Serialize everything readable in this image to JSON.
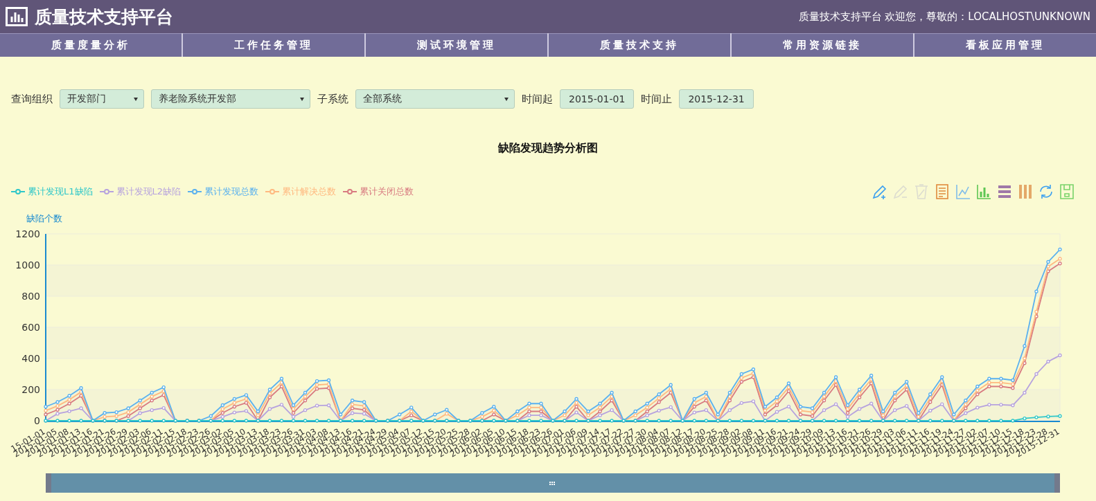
{
  "header": {
    "title": "质量技术支持平台",
    "greeting": "质量技术支持平台 欢迎您，尊敬的：LOCALHOST\\UNKNOWN"
  },
  "nav": [
    {
      "label": "质量度量分析"
    },
    {
      "label": "工作任务管理"
    },
    {
      "label": "测试环境管理"
    },
    {
      "label": "质量技术支持"
    },
    {
      "label": "常用资源链接"
    },
    {
      "label": "看板应用管理"
    }
  ],
  "filters": [
    {
      "kind": "label",
      "text": "查询组织"
    },
    {
      "kind": "select",
      "value": "开发部门"
    },
    {
      "kind": "select",
      "value": "养老险系统开发部"
    },
    {
      "kind": "label",
      "text": "子系统"
    },
    {
      "kind": "select",
      "value": "全部系统"
    },
    {
      "kind": "label",
      "text": "时间起"
    },
    {
      "kind": "date",
      "value": "2015-01-01"
    },
    {
      "kind": "label",
      "text": "时间止"
    },
    {
      "kind": "date",
      "value": "2015-12-31"
    }
  ],
  "chart": {
    "toolbox": [
      {
        "kind": "mark",
        "disabled": false
      },
      {
        "kind": "mark-undo",
        "disabled": true
      },
      {
        "kind": "mark-clear",
        "disabled": true
      },
      {
        "kind": "data-view",
        "disabled": false
      },
      {
        "kind": "line",
        "disabled": false
      },
      {
        "kind": "bar",
        "disabled": false
      },
      {
        "kind": "stack",
        "disabled": false
      },
      {
        "kind": "tiled",
        "disabled": false
      },
      {
        "kind": "restore",
        "disabled": false
      },
      {
        "kind": "save",
        "disabled": false
      }
    ],
    "chart_data": {
      "type": "line",
      "title": "缺陷发现趋势分析图",
      "ylabel": "缺陷个数",
      "ylim": [
        0,
        1200
      ],
      "yticks": [
        0,
        200,
        400,
        600,
        800,
        1000,
        1200
      ],
      "categories": [
        "15-01-01",
        "2015-01-05",
        "2015-01-08",
        "2015-01-13",
        "2015-01-16",
        "2015-01-21",
        "2015-01-26",
        "2015-01-29",
        "2015-02-03",
        "2015-02-06",
        "2015-02-11",
        "2015-02-15",
        "2015-02-18",
        "2015-02-23",
        "2015-02-26",
        "2015-03-02",
        "2015-03-05",
        "2015-03-10",
        "2015-03-13",
        "2015-03-18",
        "2015-03-23",
        "2015-03-26",
        "2015-03-31",
        "2015-04-03",
        "2015-04-08",
        "2015-04-13",
        "2015-04-16",
        "2015-04-21",
        "2015-04-24",
        "2015-04-29",
        "2015-05-04",
        "2015-05-07",
        "2015-05-12",
        "2015-05-15",
        "2015-05-20",
        "2015-05-25",
        "2015-05-28",
        "2015-06-02",
        "2015-06-05",
        "2015-06-10",
        "2015-06-15",
        "2015-06-18",
        "2015-06-23",
        "2015-06-26",
        "2015-07-01",
        "2015-07-06",
        "2015-07-09",
        "2015-07-14",
        "2015-07-17",
        "2015-07-22",
        "2015-07-27",
        "2015-07-30",
        "2015-08-04",
        "2015-08-07",
        "2015-08-12",
        "2015-08-17",
        "2015-08-20",
        "2015-08-25",
        "2015-08-28",
        "2015-09-02",
        "2015-09-08",
        "2015-09-11",
        "2015-09-16",
        "2015-09-21",
        "2015-09-24",
        "2015-09-29",
        "2015-10-09",
        "2015-10-13",
        "2015-10-16",
        "2015-10-21",
        "2015-10-26",
        "2015-10-29",
        "2015-11-03",
        "2015-11-06",
        "2015-11-11",
        "2015-11-16",
        "2015-11-19",
        "2015-11-24",
        "2015-11-27",
        "2015-12-02",
        "2015-12-07",
        "2015-12-10",
        "2015-12-15",
        "2015-12-18",
        "2015-12-23",
        "2015-12-28",
        "2015-12-31"
      ],
      "grid": true,
      "series": [
        {
          "name": "累计发现L1缺陷",
          "color": "#2ec7c9",
          "marker": true,
          "values": [
            0,
            0,
            0,
            0,
            0,
            0,
            0,
            0,
            0,
            0,
            0,
            0,
            0,
            0,
            0,
            0,
            0,
            0,
            0,
            0,
            0,
            0,
            0,
            0,
            0,
            0,
            0,
            0,
            0,
            0,
            0,
            0,
            0,
            0,
            0,
            0,
            0,
            0,
            0,
            0,
            0,
            0,
            0,
            0,
            0,
            0,
            0,
            0,
            0,
            0,
            0,
            0,
            0,
            0,
            0,
            0,
            0,
            0,
            0,
            0,
            0,
            0,
            0,
            0,
            0,
            0,
            0,
            0,
            0,
            0,
            0,
            0,
            0,
            0,
            0,
            0,
            0,
            0,
            0,
            0,
            0,
            0,
            0,
            15,
            22,
            27,
            30
          ]
        },
        {
          "name": "累计发现L2缺陷",
          "color": "#b6a2de",
          "marker": true,
          "values": [
            0,
            45,
            61,
            80,
            0,
            0,
            0,
            0,
            49,
            68,
            82,
            0,
            0,
            0,
            0,
            25,
            53,
            63,
            0,
            76,
            103,
            25,
            68,
            97,
            99,
            0,
            49,
            45,
            0,
            0,
            0,
            0,
            0,
            0,
            0,
            0,
            0,
            0,
            0,
            0,
            0,
            35,
            35,
            0,
            0,
            53,
            0,
            35,
            68,
            0,
            0,
            35,
            65,
            87,
            0,
            53,
            68,
            0,
            68,
            114,
            125,
            0,
            57,
            91,
            0,
            0,
            68,
            106,
            25,
            76,
            110,
            0,
            68,
            95,
            0,
            65,
            106,
            0,
            49,
            84,
            103,
            103,
            99,
            180,
            300,
            380,
            420
          ]
        },
        {
          "name": "累计发现总数",
          "color": "#5ab1ef",
          "marker": true,
          "values": [
            90,
            120,
            160,
            210,
            0,
            50,
            55,
            80,
            130,
            180,
            215,
            0,
            0,
            0,
            30,
            100,
            140,
            165,
            60,
            200,
            270,
            100,
            180,
            255,
            260,
            40,
            130,
            120,
            0,
            0,
            40,
            85,
            0,
            40,
            70,
            0,
            0,
            50,
            90,
            0,
            60,
            110,
            110,
            0,
            60,
            140,
            60,
            110,
            180,
            0,
            60,
            110,
            170,
            230,
            0,
            140,
            180,
            40,
            180,
            300,
            330,
            90,
            150,
            240,
            90,
            80,
            180,
            280,
            100,
            200,
            290,
            60,
            180,
            250,
            50,
            170,
            280,
            40,
            130,
            220,
            270,
            270,
            260,
            480,
            830,
            1020,
            1100
          ]
        },
        {
          "name": "累计解决总数",
          "color": "#ffb980",
          "marker": true,
          "values": [
            65,
            95,
            135,
            185,
            0,
            25,
            30,
            55,
            105,
            155,
            190,
            0,
            0,
            0,
            0,
            75,
            115,
            140,
            35,
            175,
            245,
            75,
            155,
            230,
            235,
            0,
            105,
            95,
            0,
            0,
            0,
            60,
            0,
            0,
            45,
            0,
            0,
            25,
            65,
            0,
            35,
            85,
            85,
            0,
            35,
            115,
            35,
            85,
            155,
            0,
            35,
            85,
            145,
            205,
            0,
            115,
            155,
            0,
            155,
            275,
            305,
            65,
            125,
            215,
            65,
            55,
            155,
            255,
            75,
            175,
            265,
            35,
            155,
            225,
            25,
            145,
            255,
            0,
            105,
            195,
            245,
            245,
            235,
            400,
            700,
            990,
            1040
          ]
        },
        {
          "name": "累计关闭总数",
          "color": "#d87a80",
          "marker": true,
          "values": [
            40,
            70,
            110,
            160,
            0,
            0,
            0,
            30,
            80,
            130,
            165,
            0,
            0,
            0,
            0,
            50,
            90,
            115,
            0,
            150,
            220,
            50,
            130,
            205,
            210,
            0,
            80,
            70,
            0,
            0,
            0,
            35,
            0,
            0,
            0,
            0,
            0,
            0,
            40,
            0,
            0,
            60,
            60,
            0,
            0,
            90,
            0,
            60,
            130,
            0,
            0,
            60,
            120,
            180,
            0,
            90,
            130,
            0,
            130,
            250,
            280,
            40,
            100,
            190,
            40,
            30,
            130,
            230,
            50,
            150,
            240,
            0,
            130,
            200,
            0,
            120,
            230,
            0,
            80,
            170,
            220,
            220,
            210,
            370,
            670,
            960,
            1010
          ]
        }
      ]
    }
  }
}
